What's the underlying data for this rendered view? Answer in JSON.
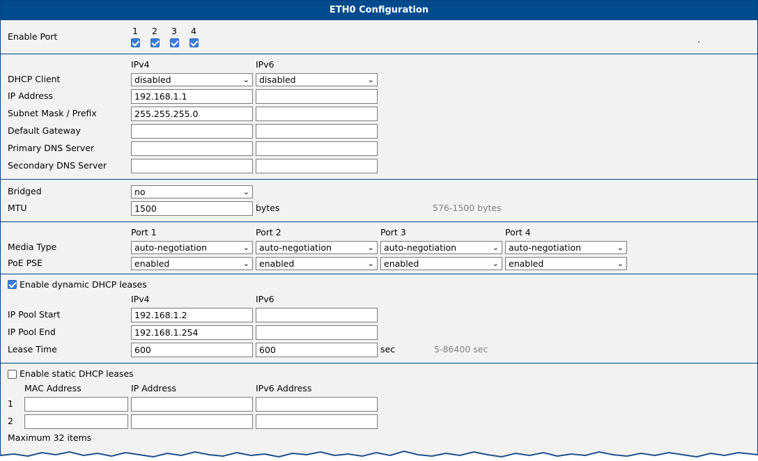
{
  "title": "ETH0 Configuration",
  "enable_port": {
    "label": "Enable Port",
    "ports": [
      "1",
      "2",
      "3",
      "4"
    ],
    "checked": [
      true,
      true,
      true,
      true
    ],
    "dot": "."
  },
  "ip": {
    "col_ipv4": "IPv4",
    "col_ipv6": "IPv6",
    "dhcp_client": {
      "label": "DHCP Client",
      "ipv4": "disabled",
      "ipv6": "disabled"
    },
    "ip_address": {
      "label": "IP Address",
      "ipv4": "192.168.1.1",
      "ipv6": ""
    },
    "subnet": {
      "label": "Subnet Mask / Prefix",
      "ipv4": "255.255.255.0",
      "ipv6": ""
    },
    "gateway": {
      "label": "Default Gateway",
      "ipv4": "",
      "ipv6": ""
    },
    "primary_dns": {
      "label": "Primary DNS Server",
      "ipv4": "",
      "ipv6": ""
    },
    "secondary_dns": {
      "label": "Secondary DNS Server",
      "ipv4": "",
      "ipv6": ""
    }
  },
  "bridge": {
    "bridged_label": "Bridged",
    "bridged_value": "no",
    "mtu_label": "MTU",
    "mtu_value": "1500",
    "mtu_unit": "bytes",
    "mtu_hint": "576-1500 bytes"
  },
  "ports": {
    "headers": [
      "Port 1",
      "Port 2",
      "Port 3",
      "Port 4"
    ],
    "media_label": "Media Type",
    "media_values": [
      "auto-negotiation",
      "auto-negotiation",
      "auto-negotiation",
      "auto-negotiation"
    ],
    "poe_label": "PoE PSE",
    "poe_values": [
      "enabled",
      "enabled",
      "enabled",
      "enabled"
    ]
  },
  "dynamic_dhcp": {
    "checkbox_label": "Enable dynamic DHCP leases",
    "checked": true,
    "col_ipv4": "IPv4",
    "col_ipv6": "IPv6",
    "pool_start": {
      "label": "IP Pool Start",
      "ipv4": "192.168.1.2",
      "ipv6": ""
    },
    "pool_end": {
      "label": "IP Pool End",
      "ipv4": "192.168.1.254",
      "ipv6": ""
    },
    "lease": {
      "label": "Lease Time",
      "ipv4": "600",
      "ipv6": "600",
      "unit": "sec",
      "hint": "5-86400 sec"
    }
  },
  "static_dhcp": {
    "checkbox_label": "Enable static DHCP leases",
    "checked": false,
    "col_mac": "MAC Address",
    "col_ip": "IP Address",
    "col_ipv6": "IPv6 Address",
    "rows": [
      {
        "num": "1",
        "mac": "",
        "ip": "",
        "ipv6": ""
      },
      {
        "num": "2",
        "mac": "",
        "ip": "",
        "ipv6": ""
      }
    ],
    "max_note": "Maximum 32 items"
  },
  "colors": {
    "header_bg": "#004b8d",
    "panel_bg": "#f2f2f2",
    "separator": "#00437f",
    "checkbox": "#3b7dd8",
    "hint_text": "#808080"
  }
}
